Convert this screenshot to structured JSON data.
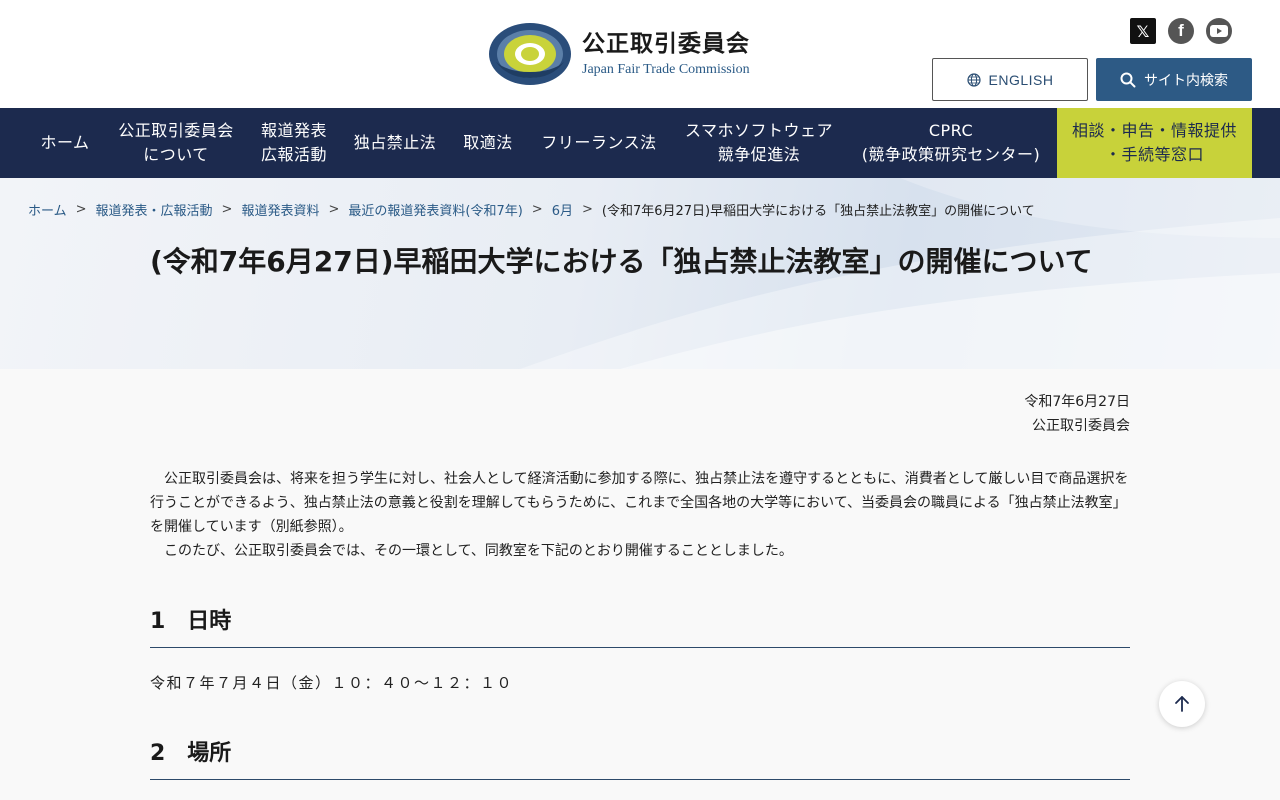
{
  "header": {
    "org_name_ja": "公正取引委員会",
    "org_name_en": "Japan Fair Trade Commission",
    "english_label": "ENGLISH",
    "search_label": "サイト内検索"
  },
  "social": {
    "x_glyph": "𝕏",
    "facebook_glyph": "f"
  },
  "nav": {
    "items": [
      {
        "line1": "ホーム",
        "line2": ""
      },
      {
        "line1": "公正取引委員会",
        "line2": "について"
      },
      {
        "line1": "報道発表",
        "line2": "広報活動"
      },
      {
        "line1": "独占禁止法",
        "line2": ""
      },
      {
        "line1": "取適法",
        "line2": ""
      },
      {
        "line1": "フリーランス法",
        "line2": ""
      },
      {
        "line1": "スマホソフトウェア",
        "line2": "競争促進法"
      },
      {
        "line1": "CPRC",
        "line2": "(競争政策研究センター)"
      },
      {
        "line1": "相談・申告・情報提供",
        "line2": "・手続等窓口"
      }
    ]
  },
  "breadcrumb": {
    "items": [
      "ホーム",
      "報道発表・広報活動",
      "報道発表資料",
      "最近の報道発表資料(令和7年)",
      "6月"
    ],
    "separator": ">",
    "current": "(令和7年6月27日)早稲田大学における「独占禁止法教室」の開催について"
  },
  "page": {
    "title": "(令和7年6月27日)早稲田大学における「独占禁止法教室」の開催について",
    "date": "令和7年6月27日",
    "issuer": "公正取引委員会",
    "paragraph1": "公正取引委員会は、将来を担う学生に対し、社会人として経済活動に参加する際に、独占禁止法を遵守するとともに、消費者として厳しい目で商品選択を行うことができるよう、独占禁止法の意義と役割を理解してもらうために、これまで全国各地の大学等において、当委員会の職員による「独占禁止法教室」を開催しています（別紙参照）。",
    "paragraph2": "このたび、公正取引委員会では、その一環として、同教室を下記のとおり開催することとしました。",
    "sections": [
      {
        "heading": "1　日時",
        "text": "令和７年７月４日（金）１０：４０〜１２：１０"
      },
      {
        "heading": "2　場所",
        "text": ""
      }
    ]
  },
  "colors": {
    "nav_bg": "#1c2a4e",
    "consult_bg": "#c8d23a",
    "search_btn_bg": "#2d5a85",
    "link": "#2a5a86"
  }
}
